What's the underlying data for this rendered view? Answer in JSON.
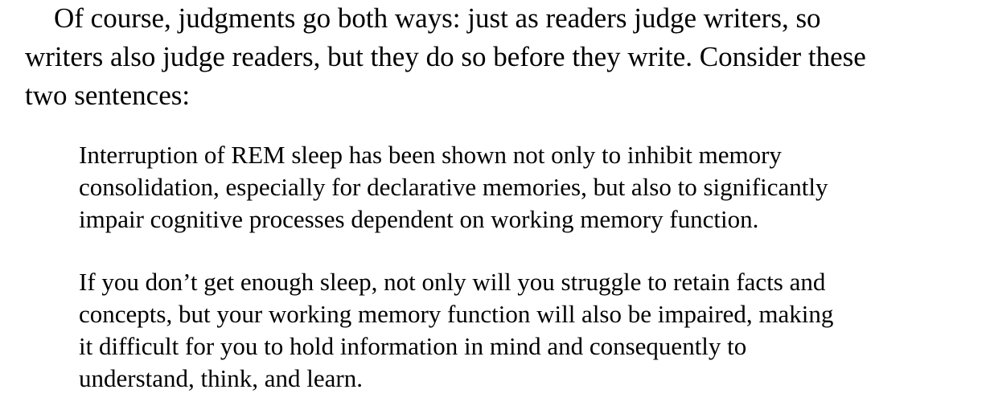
{
  "intro": {
    "lines": [
      "Of course, judgments go both ways: just as readers judge writers, so",
      "writers also judge readers, but they do so before they write. Consider these",
      "two sentences:"
    ]
  },
  "examples": [
    {
      "lines": [
        "Interruption of REM sleep has been shown not only to inhibit memory",
        "consolidation, especially for declarative memories, but also to significantly",
        "impair cognitive processes dependent on working memory function."
      ]
    },
    {
      "lines": [
        "If you don’t get enough sleep, not only will you struggle to retain facts and",
        "concepts, but your working memory function will also be impaired, making",
        "it difficult for you to hold information in mind and consequently to",
        "understand, think, and learn."
      ]
    }
  ]
}
